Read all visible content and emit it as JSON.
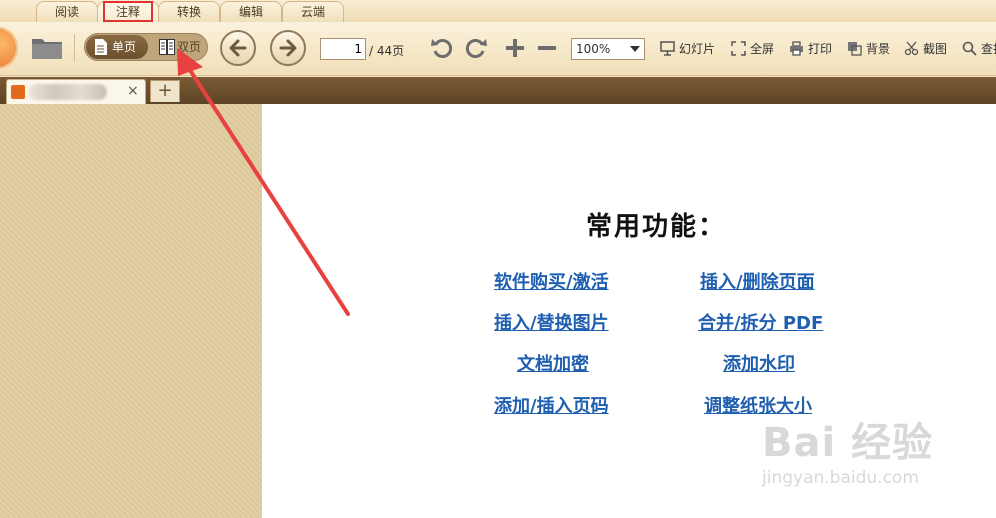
{
  "tabs": [
    "阅读",
    "注释",
    "转换",
    "编辑",
    "云端"
  ],
  "active_tab": "注释",
  "toolbar": {
    "single_page": "单页",
    "double_page": "双页",
    "page_current": "1",
    "page_total": "/ 44页",
    "zoom": "100%",
    "slideshow": "幻灯片",
    "fullscreen": "全屏",
    "print": "打印",
    "background": "背景",
    "screenshot": "截图",
    "search": "查找"
  },
  "doc_tab": {
    "close": "×",
    "new_tab": "+"
  },
  "content": {
    "heading": "常用功能：",
    "links": {
      "purchase": "软件购买/激活",
      "insert_delete_page": "插入/删除页面",
      "insert_replace_image": "插入/替换图片",
      "merge_split": "合并/拆分 PDF",
      "encrypt": "文档加密",
      "watermark": "添加水印",
      "page_number": "添加/插入页码",
      "paper_size": "调整纸张大小"
    }
  },
  "watermark": {
    "main": "Bai 经验",
    "sub": "jingyan.baidu.com"
  },
  "colors": {
    "link": "#1f5fb0",
    "highlight": "#e23333",
    "docbar": "#6b4d2b"
  }
}
